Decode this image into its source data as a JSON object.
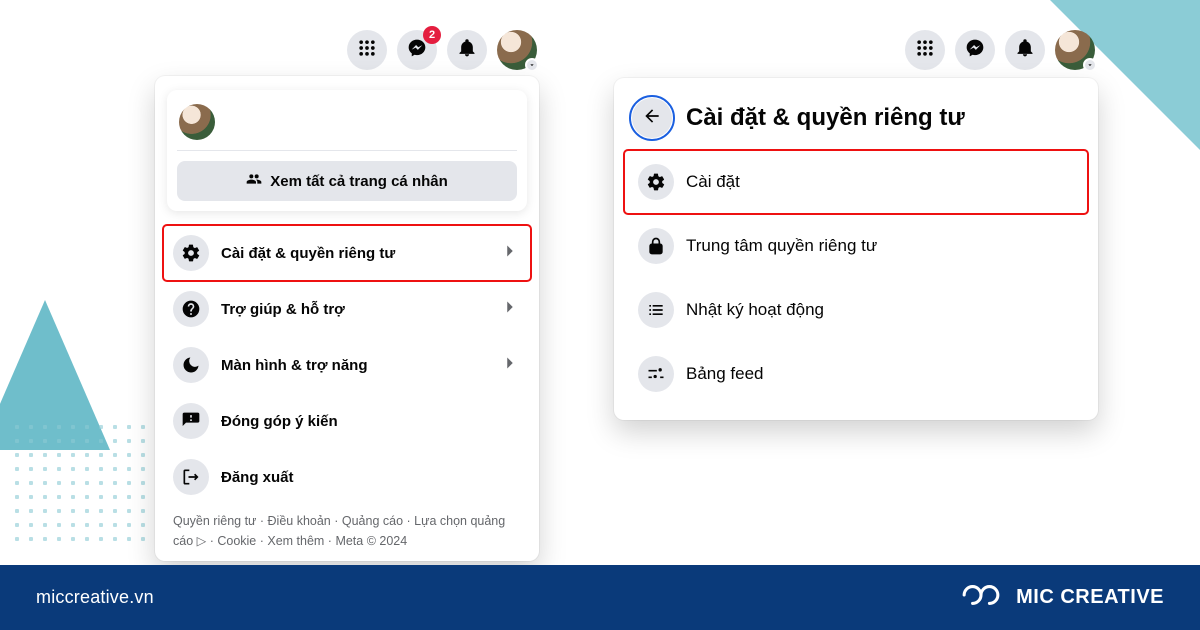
{
  "nav": {
    "badge_count": "2"
  },
  "left_panel": {
    "see_all_label": "Xem tất cả trang cá nhân",
    "items": [
      {
        "label": "Cài đặt & quyền riêng tư"
      },
      {
        "label": "Trợ giúp & hỗ trợ"
      },
      {
        "label": "Màn hình & trợ năng"
      },
      {
        "label": "Đóng góp ý kiến"
      },
      {
        "label": "Đăng xuất"
      }
    ],
    "footer": "Quyền riêng tư · Điều khoản · Quảng cáo · Lựa chọn quảng cáo ▷ · Cookie · Xem thêm · Meta © 2024"
  },
  "right_panel": {
    "title": "Cài đặt & quyền riêng tư",
    "items": [
      {
        "label": "Cài đặt"
      },
      {
        "label": "Trung tâm quyền riêng tư"
      },
      {
        "label": "Nhật ký hoạt động"
      },
      {
        "label": "Bảng feed"
      }
    ]
  },
  "footer_bar": {
    "site": "miccreative.vn",
    "brand": "MIC CREATIVE"
  },
  "colors": {
    "brand_blue": "#0a3a7a",
    "highlight": "#e11"
  }
}
